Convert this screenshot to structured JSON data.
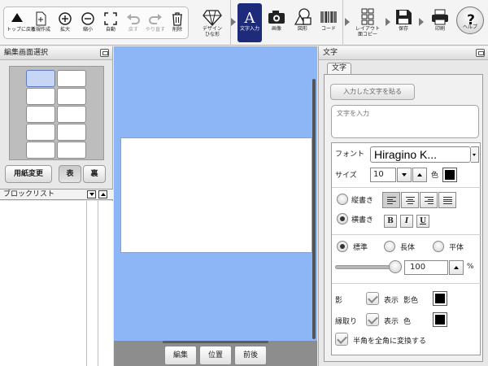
{
  "toolbar": {
    "items": [
      {
        "label": "トップに戻る",
        "icon": "home-arrow-icon"
      },
      {
        "label": "新規作成",
        "icon": "new-document-icon"
      },
      {
        "label": "拡大",
        "icon": "zoom-in-icon"
      },
      {
        "label": "縮小",
        "icon": "zoom-out-icon"
      },
      {
        "label": "自動",
        "icon": "fit-icon"
      },
      {
        "label": "戻す",
        "icon": "undo-icon",
        "disabled": true
      },
      {
        "label": "やり直す",
        "icon": "redo-icon",
        "disabled": true
      },
      {
        "label": "削除",
        "icon": "trash-icon"
      },
      {
        "label": "デザイン\nひな形",
        "icon": "gem-icon"
      },
      {
        "label": "文字入力",
        "icon": "text-a-icon",
        "active": true
      },
      {
        "label": "画像",
        "icon": "camera-icon"
      },
      {
        "label": "図形",
        "icon": "shapes-icon"
      },
      {
        "label": "コード",
        "icon": "barcode-icon"
      },
      {
        "label": "レイアウト\n面コピー",
        "icon": "layout-copy-icon"
      },
      {
        "label": "保存",
        "icon": "save-icon"
      },
      {
        "label": "印刷",
        "icon": "printer-icon"
      },
      {
        "label": "ヘルプ",
        "icon": "help-icon"
      }
    ]
  },
  "left_panel": {
    "title": "編集画面選択",
    "paper_change_button": "用紙変更",
    "front_button": "表",
    "back_button": "裏",
    "block_list_title": "ブロックリスト"
  },
  "canvas": {
    "bottom_buttons": [
      "編集",
      "位置",
      "前後"
    ],
    "background_color": "#8db6f6"
  },
  "right_panel": {
    "title": "文字",
    "tab_label": "文字",
    "paste_button": "入力した文字を貼る",
    "text_placeholder": "文字を入力",
    "font_label": "フォント",
    "font_value": "Hiragino K...",
    "size_label": "サイズ",
    "size_value": "10",
    "color_label": "色",
    "vertical_label": "縦書き",
    "horizontal_label": "横書き",
    "bold_label": "B",
    "italic_label": "I",
    "underline_label": "U",
    "width_options": [
      "標準",
      "長体",
      "平体"
    ],
    "scale_value": "100",
    "percent_label": "%",
    "shadow_label": "影",
    "shadow_show_label": "表示",
    "shadow_color_label": "影色",
    "outline_label": "縁取り",
    "outline_show_label": "表示",
    "outline_color_label": "色",
    "convert_label": "半角を全角に変換する"
  }
}
